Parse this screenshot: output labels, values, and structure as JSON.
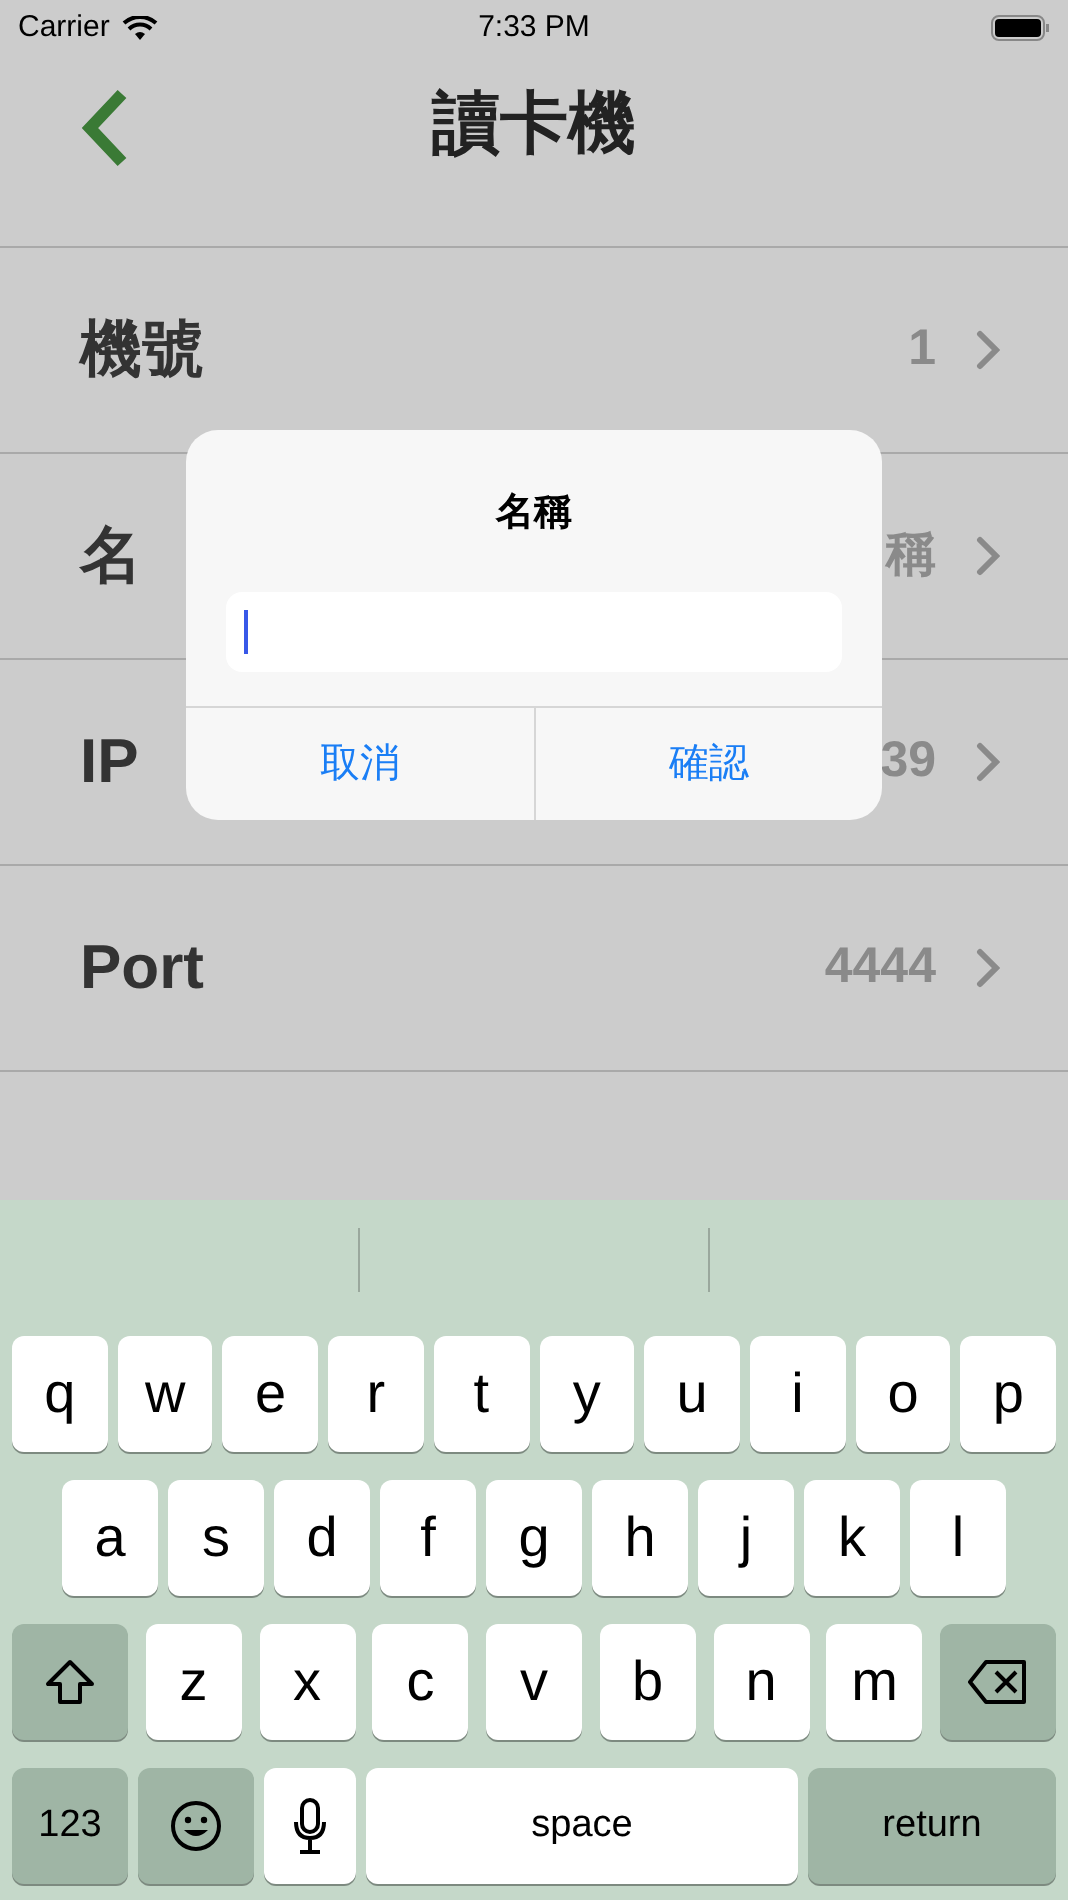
{
  "status_bar": {
    "carrier": "Carrier",
    "time": "7:33 PM"
  },
  "nav": {
    "title": "讀卡機"
  },
  "rows": [
    {
      "label": "機號",
      "value": "1"
    },
    {
      "label": "名",
      "value": "稱"
    },
    {
      "label": "IP",
      "value": "39"
    },
    {
      "label": "Port",
      "value": "4444"
    }
  ],
  "dialog": {
    "title": "名稱",
    "buttons": [
      "取消",
      "確認"
    ]
  },
  "keyboard": {
    "rows": [
      {
        "keys": [
          {
            "kind": "letter",
            "label": "q"
          },
          {
            "kind": "letter",
            "label": "w"
          },
          {
            "kind": "letter",
            "label": "e"
          },
          {
            "kind": "letter",
            "label": "r"
          },
          {
            "kind": "letter",
            "label": "t"
          },
          {
            "kind": "letter",
            "label": "y"
          },
          {
            "kind": "letter",
            "label": "u"
          },
          {
            "kind": "letter",
            "label": "i"
          },
          {
            "kind": "letter",
            "label": "o"
          },
          {
            "kind": "letter",
            "label": "p"
          }
        ]
      },
      {
        "keys": [
          {
            "kind": "letter",
            "label": "a"
          },
          {
            "kind": "letter",
            "label": "s"
          },
          {
            "kind": "letter",
            "label": "d"
          },
          {
            "kind": "letter",
            "label": "f"
          },
          {
            "kind": "letter",
            "label": "g"
          },
          {
            "kind": "letter",
            "label": "h"
          },
          {
            "kind": "letter",
            "label": "j"
          },
          {
            "kind": "letter",
            "label": "k"
          },
          {
            "kind": "letter",
            "label": "l"
          }
        ]
      },
      {
        "keys": [
          {
            "kind": "shift"
          },
          {
            "kind": "letter",
            "label": "z"
          },
          {
            "kind": "letter",
            "label": "x"
          },
          {
            "kind": "letter",
            "label": "c"
          },
          {
            "kind": "letter",
            "label": "v"
          },
          {
            "kind": "letter",
            "label": "b"
          },
          {
            "kind": "letter",
            "label": "n"
          },
          {
            "kind": "letter",
            "label": "m"
          },
          {
            "kind": "delete"
          }
        ]
      },
      {
        "keys": [
          {
            "kind": "mode",
            "label": "123"
          },
          {
            "kind": "emoji"
          },
          {
            "kind": "mic"
          },
          {
            "kind": "space",
            "label": "space"
          },
          {
            "kind": "return",
            "label": "return"
          }
        ]
      }
    ]
  }
}
